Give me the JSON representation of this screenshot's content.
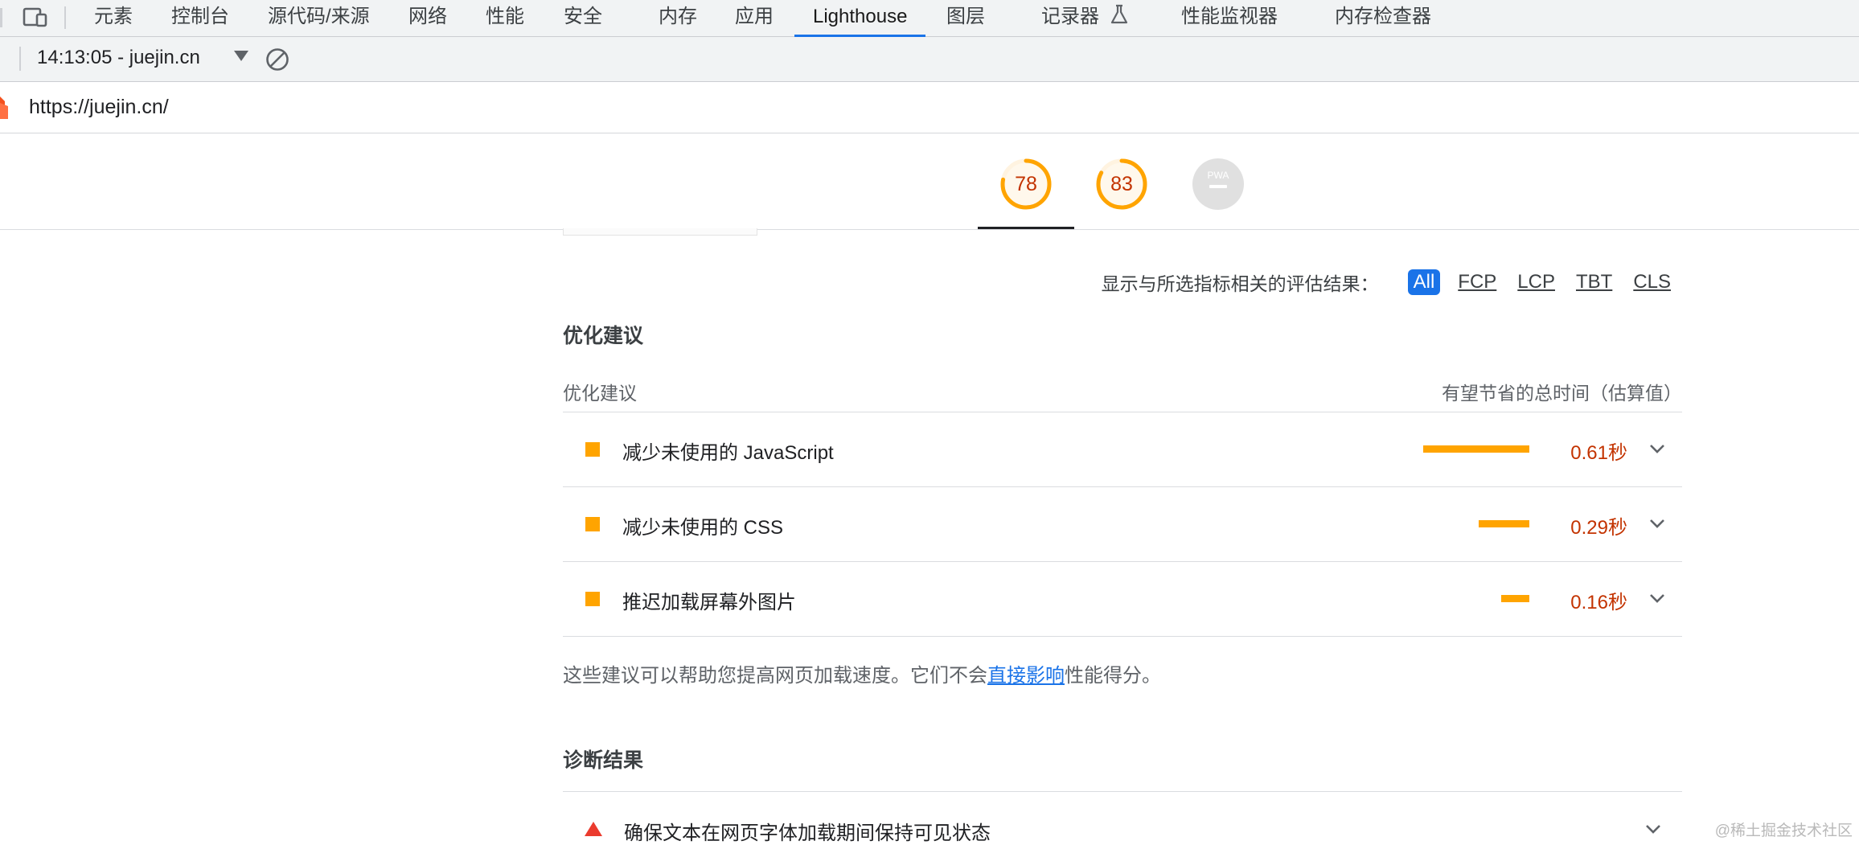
{
  "devtools": {
    "tabs": [
      {
        "label": "元素"
      },
      {
        "label": "控制台"
      },
      {
        "label": "源代码/来源"
      },
      {
        "label": "网络"
      },
      {
        "label": "性能"
      },
      {
        "label": "安全"
      },
      {
        "label": "内存"
      },
      {
        "label": "应用"
      },
      {
        "label": "Lighthouse",
        "active": true
      },
      {
        "label": "图层"
      },
      {
        "label": "记录器"
      },
      {
        "label": "性能监视器"
      },
      {
        "label": "内存检查器"
      }
    ],
    "icons": [
      "device-toggle-icon",
      "flask-icon",
      "dropdown-arrow-icon",
      "clear-icon",
      "lighthouse-logo-icon",
      "chevron-down-icon",
      "warning-triangle-icon"
    ],
    "accent_color": "#1a73e8"
  },
  "toolbar": {
    "report_selector": "14:13:05 - juejin.cn"
  },
  "urlbar": {
    "url": "https://juejin.cn/"
  },
  "scores": [
    {
      "value": "78",
      "fraction": 0.78,
      "color": "#ffa400"
    },
    {
      "value": "83",
      "fraction": 0.83,
      "color": "#ffa400"
    },
    {
      "value": "PWA",
      "color": "#bdbdbd"
    }
  ],
  "filter": {
    "label": "显示与所选指标相关的评估结果：",
    "chips": [
      "All",
      "FCP",
      "LCP",
      "TBT",
      "CLS"
    ]
  },
  "opportunities": {
    "section_title": "优化建议",
    "column_left": "优化建议",
    "column_right": "有望节省的总时间（估算值）",
    "items": [
      {
        "title": "减少未使用的 JavaScript",
        "savings": "0.61秒",
        "savings_sec": 0.61
      },
      {
        "title": "减少未使用的 CSS",
        "savings": "0.29秒",
        "savings_sec": 0.29
      },
      {
        "title": "推迟加载屏幕外图片",
        "savings": "0.16秒",
        "savings_sec": 0.16
      }
    ],
    "note_before": "这些建议可以帮助您提高网页加载速度。它们不会",
    "note_link": "直接影响",
    "note_after": "性能得分。"
  },
  "diagnostics": {
    "section_title": "诊断结果",
    "items": [
      {
        "title": "确保文本在网页字体加载期间保持可见状态",
        "severity_color": "#eb3b2e"
      }
    ]
  },
  "watermark": "@稀土掘金技术社区",
  "status_colors": {
    "average": "#ffa400",
    "fail_text": "#c33300",
    "fail": "#eb3b2e"
  }
}
